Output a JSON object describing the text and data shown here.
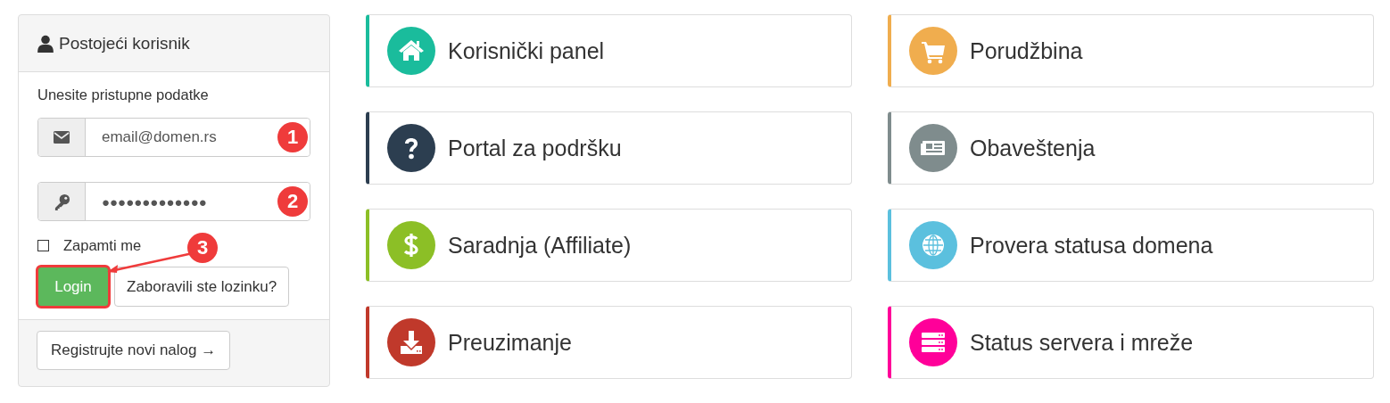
{
  "login": {
    "title": "Postojeći korisnik",
    "prompt": "Unesite pristupne podatke",
    "email": {
      "value": "email@domen.rs",
      "marker": "1"
    },
    "password": {
      "value": "●●●●●●●●●●●●●",
      "marker": "2"
    },
    "remember": {
      "label": "Zapamti me",
      "checked": false
    },
    "login_button": {
      "label": "Login",
      "highlighted": true,
      "marker": "3"
    },
    "forgot_button": "Zaboravili ste lozinku?",
    "register_button": "Registrujte novi nalog →"
  },
  "tiles": [
    {
      "label": "Korisnički panel",
      "kind": "home",
      "color": "#1abc9c"
    },
    {
      "label": "Porudžbina",
      "kind": "cart",
      "color": "#f0ad4e"
    },
    {
      "label": "Portal za podršku",
      "kind": "question",
      "color": "#2c3e50"
    },
    {
      "label": "Obaveštenja",
      "kind": "news",
      "color": "#7f8c8d"
    },
    {
      "label": "Saradnja (Affiliate)",
      "kind": "dollar",
      "color": "#8cbf26"
    },
    {
      "label": "Provera statusa domena",
      "kind": "globe",
      "color": "#5bc0de"
    },
    {
      "label": "Preuzimanje",
      "kind": "download",
      "color": "#c0392b"
    },
    {
      "label": "Status servera i mreže",
      "kind": "server",
      "color": "#ff0099"
    }
  ]
}
